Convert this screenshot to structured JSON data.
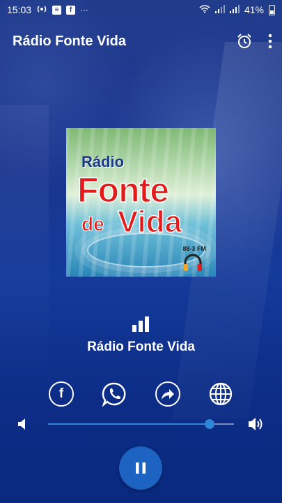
{
  "status_bar": {
    "time": "15:03",
    "battery": "41%",
    "left_icons": [
      "broadcast-icon",
      "app-notification-icon",
      "facebook-notification-icon",
      "more-notifications-icon"
    ],
    "right_icons": [
      "wifi-icon",
      "signal-icon",
      "signal-icon",
      "battery-icon"
    ]
  },
  "app_bar": {
    "title": "Rádio Fonte Vida",
    "actions": [
      "alarm-icon",
      "overflow-menu-icon"
    ]
  },
  "artwork": {
    "brand_line1": "Rádio",
    "brand_line2": "Fonte",
    "brand_line3a": "de",
    "brand_line3b": "Vida",
    "frequency": "88-3 FM"
  },
  "now_playing": {
    "station_name": "Rádio Fonte Vida",
    "equalizer_icon": "equalizer-bars-icon"
  },
  "social": [
    "facebook-icon",
    "whatsapp-icon",
    "share-icon",
    "website-globe-icon"
  ],
  "volume": {
    "level": 0.87
  },
  "player": {
    "state": "playing",
    "button_icon": "pause-icon"
  },
  "colors": {
    "accent": "#2f86d8",
    "primary": "#1d63c2",
    "background": "#143a9a"
  }
}
